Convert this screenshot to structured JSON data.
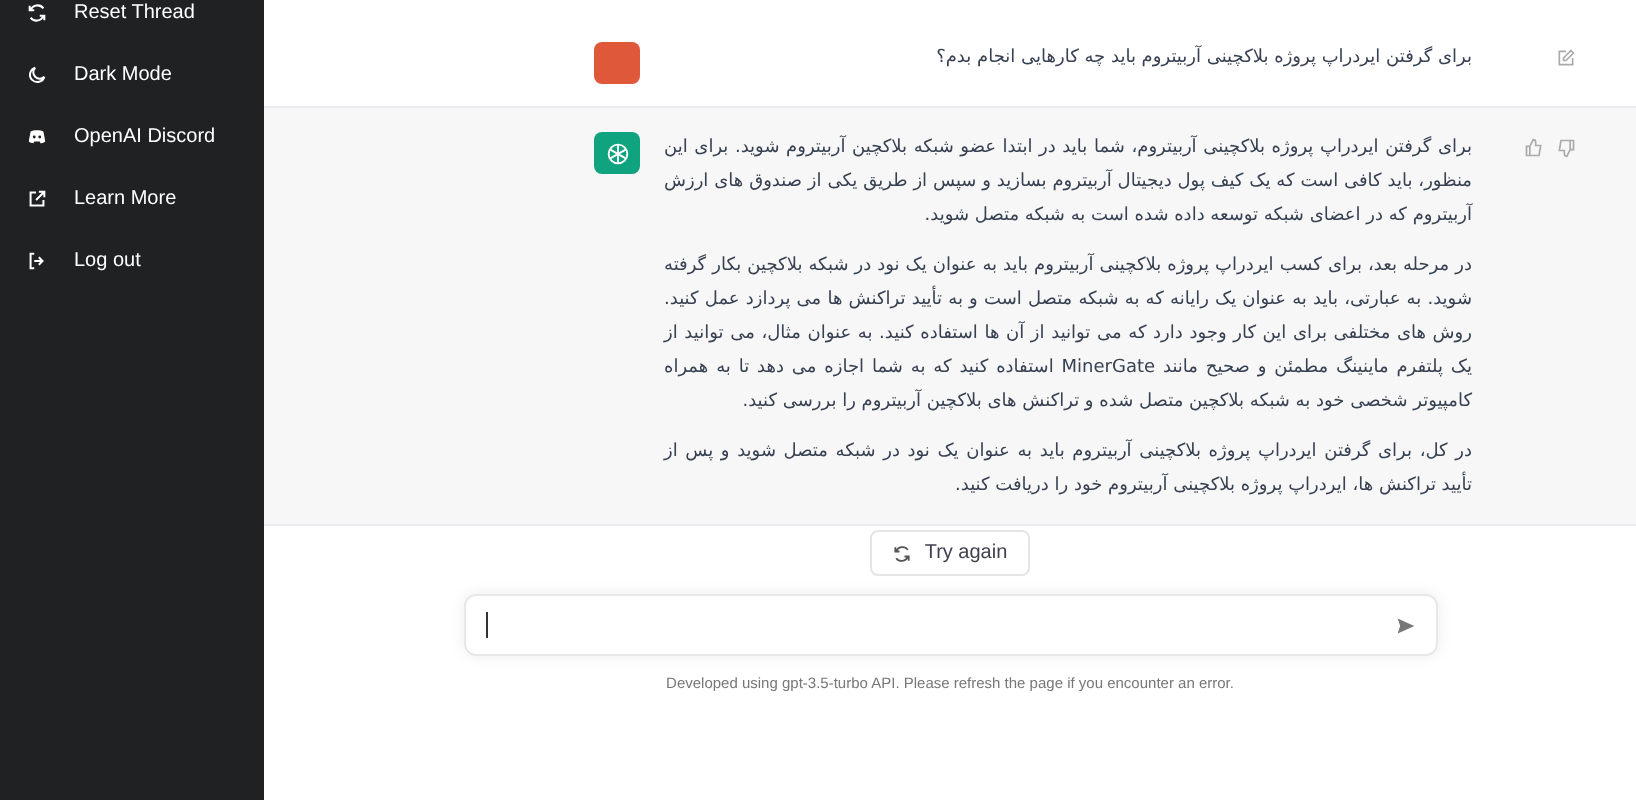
{
  "sidebar": {
    "items": [
      {
        "kind": "reset",
        "label": "Reset Thread"
      },
      {
        "kind": "dark",
        "label": "Dark Mode"
      },
      {
        "kind": "discord",
        "label": "OpenAI Discord"
      },
      {
        "kind": "external",
        "label": "Learn More"
      },
      {
        "kind": "logout",
        "label": "Log out"
      }
    ]
  },
  "messages": [
    {
      "kind": "user",
      "paragraphs": [
        "برای گرفتن ایردراپ پروژه بلاکچینی آربیتروم باید چه کارهایی انجام بدم؟"
      ]
    },
    {
      "kind": "assistant",
      "paragraphs": [
        "برای گرفتن ایردراپ پروژه بلاکچینی آربیتروم، شما باید در ابتدا عضو شبکه بلاکچین آربیتروم شوید. برای این منظور، باید کافی است که یک کیف پول دیجیتال آربیتروم بسازید و سپس از طریق یکی از صندوق های ارزش آربیتروم که در اعضای شبکه توسعه داده شده است به شبکه متصل شوید.",
        "در مرحله بعد، برای کسب ایردراپ پروژه بلاکچینی آربیتروم باید به عنوان یک نود در شبکه بلاکچین بکار گرفته شوید. به عبارتی، باید به عنوان یک رایانه که به شبکه متصل است و به تأیید تراکنش ها می پردازد عمل کنید. روش های مختلفی برای این کار وجود دارد که می توانید از آن ها استفاده کنید. به عنوان مثال، می توانید از یک پلتفرم ماینینگ مطمئن و صحیح مانند MinerGate استفاده کنید که به شما اجازه می دهد تا به همراه کامپیوتر شخصی خود به شبکه بلاکچین متصل شده و تراکنش های بلاکچین آربیتروم را بررسی کنید.",
        "در کل، برای گرفتن ایردراپ پروژه بلاکچینی آربیتروم باید به عنوان یک نود در شبکه متصل شوید و پس از تأیید تراکنش ها، ایردراپ پروژه بلاکچینی آربیتروم خود را دریافت کنید."
      ]
    }
  ],
  "retry_button": "Try again",
  "footer": "Developed using gpt-3.5-turbo API. Please refresh the page if you encounter an error."
}
